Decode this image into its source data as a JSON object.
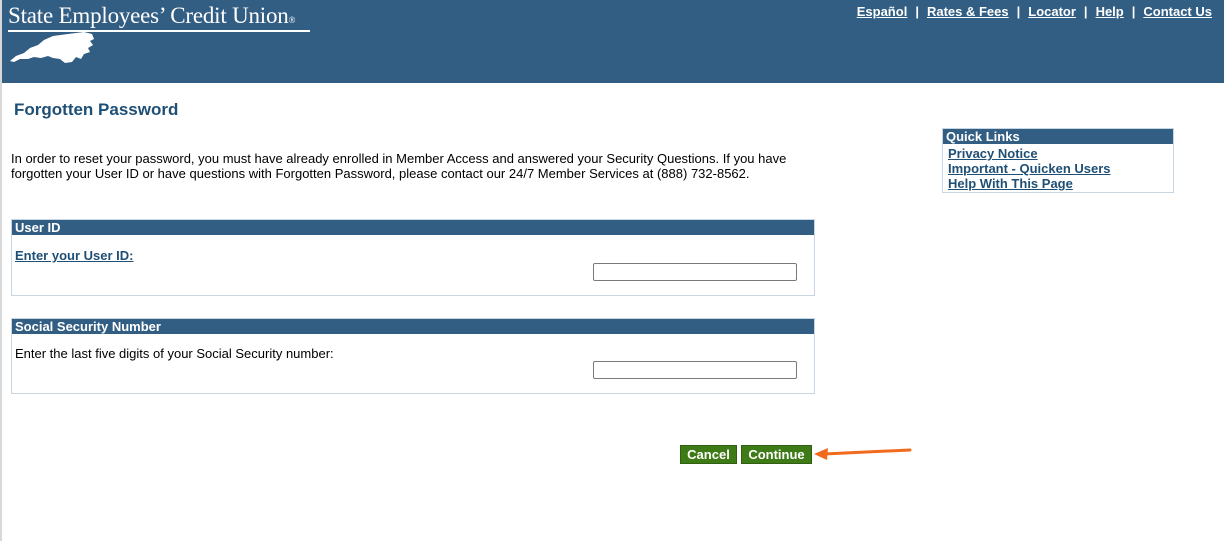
{
  "header": {
    "brand": "State Employees’ Credit Union",
    "brand_mark": "®",
    "links": [
      "Español",
      "Rates & Fees",
      "Locator",
      "Help",
      "Contact Us"
    ],
    "separator": "|"
  },
  "page": {
    "title": "Forgotten Password",
    "intro": "In order to reset your password, you must have already enrolled in Member Access and answered your Security Questions. If you have forgotten your User ID or have questions with Forgotten Password, please contact our 24/7 Member Services at (888) 732-8562."
  },
  "user_id_section": {
    "header": "User ID",
    "label": "Enter your User ID:",
    "value": ""
  },
  "ssn_section": {
    "header": "Social Security Number",
    "label": "Enter the last five digits of your Social Security number:",
    "value": ""
  },
  "buttons": {
    "cancel": "Cancel",
    "continue": "Continue"
  },
  "quick_links": {
    "title": "Quick Links",
    "items": [
      "Privacy Notice",
      "Important - Quicken Users",
      "Help With This Page"
    ]
  },
  "colors": {
    "header_bg": "#335e83",
    "button_bg": "#3e7a16",
    "link": "#1f4f75",
    "annotation_arrow": "#f26a1b"
  }
}
